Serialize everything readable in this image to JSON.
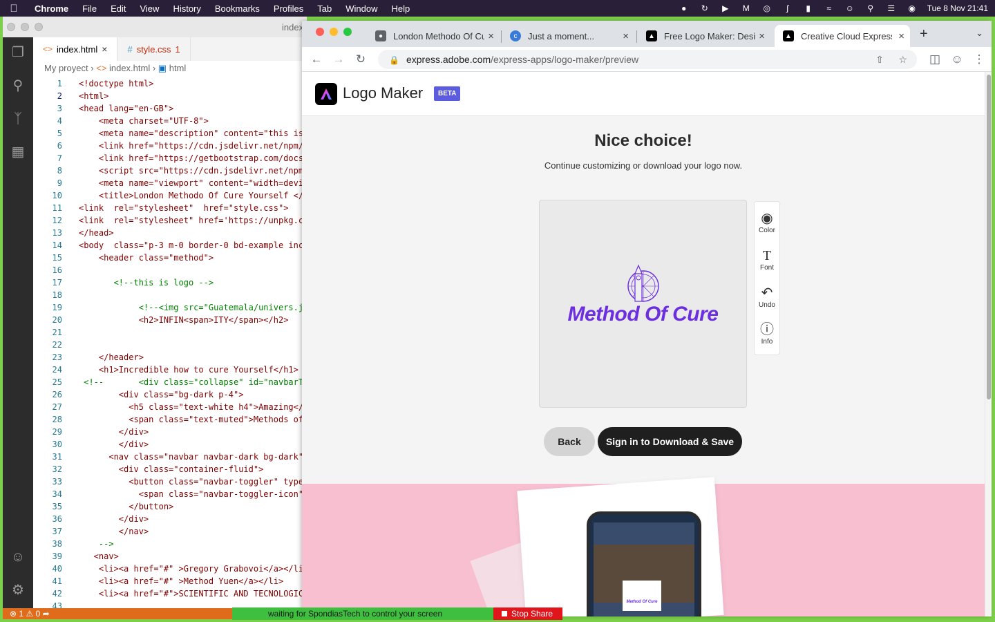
{
  "menubar": {
    "app": "Chrome",
    "items": [
      "File",
      "Edit",
      "View",
      "History",
      "Bookmarks",
      "Profiles",
      "Tab",
      "Window",
      "Help"
    ],
    "datetime": "Tue 8 Nov  21:41"
  },
  "vscode": {
    "title": "index",
    "tabs": [
      {
        "label": "index.html"
      },
      {
        "label": "style.css",
        "badge": "1"
      }
    ],
    "breadcrumb": [
      "My proyect",
      "index.html",
      "html"
    ],
    "status": {
      "errors": "1",
      "warnings": "0"
    },
    "lines": [
      {
        "n": "1",
        "text": "<!doctype html>"
      },
      {
        "n": "2",
        "text": "<html>"
      },
      {
        "n": "3",
        "text": "<head lang=\"en-GB\">"
      },
      {
        "n": "4",
        "text": "    <meta charset=\"UTF-8\">"
      },
      {
        "n": "5",
        "text": "    <meta name=\"description\" content=\"this is"
      },
      {
        "n": "6",
        "text": "    <link href=\"https://cdn.jsdelivr.net/npm/"
      },
      {
        "n": "7",
        "text": "    <link href=\"https://getbootstrap.com/docs"
      },
      {
        "n": "8",
        "text": "    <script src=\"https://cdn.jsdelivr.net/npm"
      },
      {
        "n": "9",
        "text": "    <meta name=\"viewport\" content=\"width=devi"
      },
      {
        "n": "10",
        "text": "    <title>London Methodo Of Cure Yourself </"
      },
      {
        "n": "11",
        "text": "<link  rel=\"stylesheet\"  href=\"style.css\">"
      },
      {
        "n": "12",
        "text": "<link  rel=\"stylesheet\" href='https://unpkg.c"
      },
      {
        "n": "13",
        "text": "</head>"
      },
      {
        "n": "14",
        "text": "<body  class=\"p-3 m-0 border-0 bd-example inc"
      },
      {
        "n": "15",
        "text": "    <header class=\"method\">"
      },
      {
        "n": "16",
        "text": ""
      },
      {
        "n": "17",
        "text": "       <!--this is logo -->"
      },
      {
        "n": "18",
        "text": ""
      },
      {
        "n": "19",
        "text": "            <!--<img src=\"Guatemala/univers.j"
      },
      {
        "n": "20",
        "text": "            <h2>INFIN<span>ITY</span></h2>"
      },
      {
        "n": "21",
        "text": ""
      },
      {
        "n": "22",
        "text": ""
      },
      {
        "n": "23",
        "text": "    </header>"
      },
      {
        "n": "24",
        "text": "    <h1>Incredible how to cure Yourself</h1>"
      },
      {
        "n": "25",
        "text": " <!--       <div class=\"collapse\" id=\"navbarT"
      },
      {
        "n": "26",
        "text": "        <div class=\"bg-dark p-4\">"
      },
      {
        "n": "27",
        "text": "          <h5 class=\"text-white h4\">Amazing</"
      },
      {
        "n": "28",
        "text": "          <span class=\"text-muted\">Methods of"
      },
      {
        "n": "29",
        "text": "        </div>"
      },
      {
        "n": "30",
        "text": "        </div>"
      },
      {
        "n": "31",
        "text": "      <nav class=\"navbar navbar-dark bg-dark\""
      },
      {
        "n": "32",
        "text": "        <div class=\"container-fluid\">"
      },
      {
        "n": "33",
        "text": "          <button class=\"navbar-toggler\" type"
      },
      {
        "n": "34",
        "text": "            <span class=\"navbar-toggler-icon\""
      },
      {
        "n": "35",
        "text": "          </button>"
      },
      {
        "n": "36",
        "text": "        </div>"
      },
      {
        "n": "37",
        "text": "        </nav>"
      },
      {
        "n": "38",
        "text": "    -->"
      },
      {
        "n": "39",
        "text": "   <nav>"
      },
      {
        "n": "40",
        "text": "    <li><a href=\"#\" >Gregory Grabovoi</a></li"
      },
      {
        "n": "41",
        "text": "    <li><a href=\"#\" >Method Yuen</a></li>"
      },
      {
        "n": "42",
        "text": "    <li><a href=\"#\">SCIENTIFIC AND TECNOLOGIC"
      },
      {
        "n": "43",
        "text": ""
      }
    ]
  },
  "chrome": {
    "tabs": [
      {
        "title": "London Methodo Of Cu"
      },
      {
        "title": "Just a moment..."
      },
      {
        "title": "Free Logo Maker: Desig"
      },
      {
        "title": "Creative Cloud Express"
      }
    ],
    "url_domain": "express.adobe.com",
    "url_path": "/express-apps/logo-maker/preview"
  },
  "logomaker": {
    "title": "Logo Maker",
    "badge": "BETA",
    "heading": "Nice choice!",
    "subheading": "Continue customizing or download your logo now.",
    "logo_text": "Method Of Cure",
    "mini_logo_text": "Method Of Cure",
    "tools": [
      "Color",
      "Font",
      "Undo",
      "Info"
    ],
    "back_label": "Back",
    "sign_label": "Sign in to Download & Save",
    "brand_color": "#6b2ee0"
  },
  "screenshare": {
    "waiting_text": "waiting for SpondiasTech to control your screen",
    "stop_label": "Stop Share"
  }
}
